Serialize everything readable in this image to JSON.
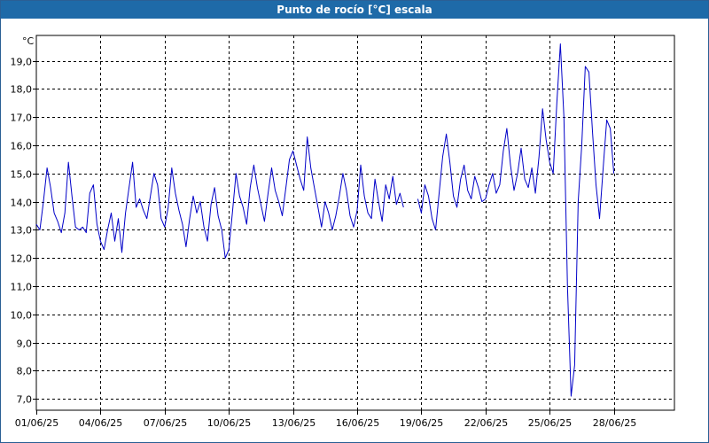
{
  "window": {
    "title": "Punto de rocío [°C] escala"
  },
  "chart_data": {
    "type": "line",
    "title": "Punto de rocío [°C] escala",
    "yunit": "°C",
    "xlabel": "",
    "ylabel": "",
    "ylim": [
      6.6,
      19.9
    ],
    "xlim": [
      "2025-06-01",
      "2025-06-30T20:00"
    ],
    "grid": true,
    "yticks": [
      "7,0",
      "8,0",
      "9,0",
      "10,0",
      "11,0",
      "12,0",
      "13,0",
      "14,0",
      "15,0",
      "16,0",
      "17,0",
      "18,0",
      "19,0"
    ],
    "xticks": [
      "01/06/25",
      "04/06/25",
      "07/06/25",
      "10/06/25",
      "13/06/25",
      "16/06/25",
      "19/06/25",
      "22/06/25",
      "25/06/25",
      "28/06/25"
    ],
    "colors": {
      "series": "#0000c8",
      "grid": "#000000"
    },
    "series": [
      {
        "segments": [
          [
            [
              "2025-06-01T00:00",
              13.2
            ],
            [
              "2025-06-01T04:00",
              13.0
            ],
            [
              "2025-06-01T08:00",
              14.0
            ],
            [
              "2025-06-01T12:00",
              15.2
            ],
            [
              "2025-06-01T16:00",
              14.5
            ],
            [
              "2025-06-01T20:00",
              13.6
            ],
            [
              "2025-06-02T00:00",
              13.3
            ],
            [
              "2025-06-02T04:00",
              12.9
            ],
            [
              "2025-06-02T08:00",
              13.6
            ],
            [
              "2025-06-02T12:00",
              15.4
            ],
            [
              "2025-06-02T16:00",
              14.2
            ],
            [
              "2025-06-02T20:00",
              13.1
            ],
            [
              "2025-06-03T00:00",
              13.0
            ],
            [
              "2025-06-03T04:00",
              13.1
            ],
            [
              "2025-06-03T08:00",
              12.9
            ],
            [
              "2025-06-03T12:00",
              14.3
            ],
            [
              "2025-06-03T16:00",
              14.6
            ],
            [
              "2025-06-03T20:00",
              13.2
            ],
            [
              "2025-06-04T00:00",
              12.6
            ],
            [
              "2025-06-04T04:00",
              12.3
            ],
            [
              "2025-06-04T08:00",
              13.0
            ],
            [
              "2025-06-04T12:00",
              13.6
            ],
            [
              "2025-06-04T16:00",
              12.6
            ],
            [
              "2025-06-04T20:00",
              13.4
            ],
            [
              "2025-06-05T00:00",
              12.2
            ],
            [
              "2025-06-05T04:00",
              13.6
            ],
            [
              "2025-06-05T08:00",
              14.5
            ],
            [
              "2025-06-05T12:00",
              15.4
            ],
            [
              "2025-06-05T16:00",
              13.8
            ],
            [
              "2025-06-05T20:00",
              14.1
            ],
            [
              "2025-06-06T00:00",
              13.7
            ],
            [
              "2025-06-06T04:00",
              13.4
            ],
            [
              "2025-06-06T08:00",
              14.2
            ],
            [
              "2025-06-06T12:00",
              15.0
            ],
            [
              "2025-06-06T16:00",
              14.6
            ],
            [
              "2025-06-06T20:00",
              13.4
            ],
            [
              "2025-06-07T00:00",
              13.1
            ],
            [
              "2025-06-07T04:00",
              13.8
            ],
            [
              "2025-06-07T08:00",
              15.2
            ],
            [
              "2025-06-07T12:00",
              14.3
            ],
            [
              "2025-06-07T16:00",
              13.7
            ],
            [
              "2025-06-07T20:00",
              13.2
            ],
            [
              "2025-06-08T00:00",
              12.4
            ],
            [
              "2025-06-08T04:00",
              13.4
            ],
            [
              "2025-06-08T08:00",
              14.2
            ],
            [
              "2025-06-08T12:00",
              13.6
            ],
            [
              "2025-06-08T16:00",
              14.0
            ],
            [
              "2025-06-08T20:00",
              13.1
            ],
            [
              "2025-06-09T00:00",
              12.6
            ],
            [
              "2025-06-09T04:00",
              13.9
            ],
            [
              "2025-06-09T08:00",
              14.5
            ],
            [
              "2025-06-09T12:00",
              13.5
            ],
            [
              "2025-06-09T16:00",
              13.0
            ],
            [
              "2025-06-09T20:00",
              12.0
            ],
            [
              "2025-06-10T00:00",
              12.3
            ],
            [
              "2025-06-10T04:00",
              13.6
            ],
            [
              "2025-06-10T08:00",
              15.0
            ],
            [
              "2025-06-10T12:00",
              14.2
            ],
            [
              "2025-06-10T16:00",
              13.8
            ],
            [
              "2025-06-10T20:00",
              13.2
            ],
            [
              "2025-06-11T00:00",
              14.5
            ],
            [
              "2025-06-11T04:00",
              15.3
            ],
            [
              "2025-06-11T08:00",
              14.5
            ],
            [
              "2025-06-11T12:00",
              13.9
            ],
            [
              "2025-06-11T16:00",
              13.3
            ],
            [
              "2025-06-11T20:00",
              14.3
            ],
            [
              "2025-06-12T00:00",
              15.2
            ],
            [
              "2025-06-12T04:00",
              14.4
            ],
            [
              "2025-06-12T08:00",
              14.0
            ],
            [
              "2025-06-12T12:00",
              13.5
            ],
            [
              "2025-06-12T16:00",
              14.5
            ],
            [
              "2025-06-12T20:00",
              15.5
            ],
            [
              "2025-06-13T00:00",
              15.8
            ],
            [
              "2025-06-13T04:00",
              15.3
            ],
            [
              "2025-06-13T08:00",
              14.8
            ],
            [
              "2025-06-13T12:00",
              14.4
            ],
            [
              "2025-06-13T16:00",
              16.3
            ],
            [
              "2025-06-13T20:00",
              15.2
            ],
            [
              "2025-06-14T00:00",
              14.5
            ],
            [
              "2025-06-14T04:00",
              13.8
            ],
            [
              "2025-06-14T08:00",
              13.1
            ],
            [
              "2025-06-14T12:00",
              14.0
            ],
            [
              "2025-06-14T16:00",
              13.6
            ],
            [
              "2025-06-14T20:00",
              13.0
            ],
            [
              "2025-06-15T00:00",
              13.5
            ],
            [
              "2025-06-15T04:00",
              14.2
            ],
            [
              "2025-06-15T08:00",
              15.0
            ],
            [
              "2025-06-15T12:00",
              14.4
            ],
            [
              "2025-06-15T16:00",
              13.5
            ],
            [
              "2025-06-15T20:00",
              13.1
            ],
            [
              "2025-06-16T00:00",
              13.7
            ],
            [
              "2025-06-16T04:00",
              15.3
            ],
            [
              "2025-06-16T08:00",
              14.2
            ],
            [
              "2025-06-16T12:00",
              13.6
            ],
            [
              "2025-06-16T16:00",
              13.4
            ],
            [
              "2025-06-16T20:00",
              14.8
            ],
            [
              "2025-06-17T00:00",
              14.0
            ],
            [
              "2025-06-17T04:00",
              13.3
            ],
            [
              "2025-06-17T08:00",
              14.6
            ],
            [
              "2025-06-17T12:00",
              14.1
            ],
            [
              "2025-06-17T16:00",
              14.9
            ],
            [
              "2025-06-17T20:00",
              13.9
            ],
            [
              "2025-06-18T00:00",
              14.3
            ],
            [
              "2025-06-18T04:00",
              13.8
            ]
          ],
          [
            [
              "2025-06-18T20:00",
              14.1
            ],
            [
              "2025-06-19T00:00",
              13.6
            ],
            [
              "2025-06-19T04:00",
              14.6
            ],
            [
              "2025-06-19T08:00",
              14.2
            ],
            [
              "2025-06-19T12:00",
              13.4
            ],
            [
              "2025-06-19T16:00",
              13.0
            ],
            [
              "2025-06-19T20:00",
              14.3
            ],
            [
              "2025-06-20T00:00",
              15.6
            ],
            [
              "2025-06-20T04:00",
              16.4
            ],
            [
              "2025-06-20T08:00",
              15.4
            ],
            [
              "2025-06-20T12:00",
              14.2
            ],
            [
              "2025-06-20T16:00",
              13.8
            ],
            [
              "2025-06-20T20:00",
              14.8
            ],
            [
              "2025-06-21T00:00",
              15.3
            ],
            [
              "2025-06-21T04:00",
              14.4
            ],
            [
              "2025-06-21T08:00",
              14.1
            ],
            [
              "2025-06-21T12:00",
              14.9
            ],
            [
              "2025-06-21T16:00",
              14.5
            ],
            [
              "2025-06-21T20:00",
              14.0
            ],
            [
              "2025-06-22T00:00",
              14.1
            ],
            [
              "2025-06-22T04:00",
              14.6
            ],
            [
              "2025-06-22T08:00",
              15.0
            ],
            [
              "2025-06-22T12:00",
              14.3
            ],
            [
              "2025-06-22T16:00",
              14.6
            ],
            [
              "2025-06-22T20:00",
              15.8
            ],
            [
              "2025-06-23T00:00",
              16.6
            ],
            [
              "2025-06-23T04:00",
              15.3
            ],
            [
              "2025-06-23T08:00",
              14.4
            ],
            [
              "2025-06-23T12:00",
              15.0
            ],
            [
              "2025-06-23T16:00",
              15.9
            ],
            [
              "2025-06-23T20:00",
              14.8
            ],
            [
              "2025-06-24T00:00",
              14.5
            ],
            [
              "2025-06-24T04:00",
              15.2
            ],
            [
              "2025-06-24T08:00",
              14.3
            ],
            [
              "2025-06-24T12:00",
              15.6
            ],
            [
              "2025-06-24T16:00",
              17.3
            ],
            [
              "2025-06-24T20:00",
              16.2
            ],
            [
              "2025-06-25T00:00",
              15.4
            ],
            [
              "2025-06-25T04:00",
              15.0
            ],
            [
              "2025-06-25T08:00",
              17.5
            ],
            [
              "2025-06-25T12:00",
              19.6
            ],
            [
              "2025-06-25T16:00",
              17.0
            ],
            [
              "2025-06-25T20:00",
              11.0
            ],
            [
              "2025-06-26T00:00",
              7.1
            ],
            [
              "2025-06-26T04:00",
              8.2
            ],
            [
              "2025-06-26T08:00",
              14.0
            ],
            [
              "2025-06-26T12:00",
              16.0
            ],
            [
              "2025-06-26T16:00",
              18.8
            ],
            [
              "2025-06-26T20:00",
              18.6
            ],
            [
              "2025-06-27T00:00",
              16.5
            ],
            [
              "2025-06-27T04:00",
              14.6
            ],
            [
              "2025-06-27T08:00",
              13.4
            ],
            [
              "2025-06-27T12:00",
              15.2
            ],
            [
              "2025-06-27T16:00",
              16.9
            ],
            [
              "2025-06-27T20:00",
              16.6
            ],
            [
              "2025-06-28T00:00",
              15.0
            ]
          ]
        ]
      }
    ]
  }
}
